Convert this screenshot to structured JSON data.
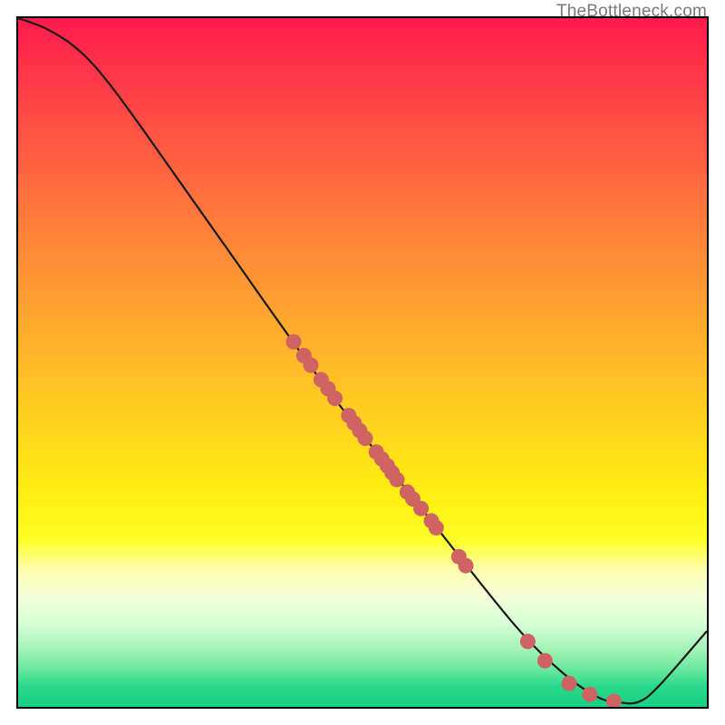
{
  "attribution": "TheBottleneck.com",
  "chart_data": {
    "type": "line",
    "title": "",
    "xlabel": "",
    "ylabel": "",
    "xlim": [
      0,
      100
    ],
    "ylim": [
      0,
      100
    ],
    "curve": [
      {
        "x": 0,
        "y": 100
      },
      {
        "x": 4,
        "y": 98.5
      },
      {
        "x": 8,
        "y": 96
      },
      {
        "x": 12,
        "y": 92
      },
      {
        "x": 18,
        "y": 84
      },
      {
        "x": 30,
        "y": 67
      },
      {
        "x": 45,
        "y": 46
      },
      {
        "x": 60,
        "y": 27
      },
      {
        "x": 72,
        "y": 12
      },
      {
        "x": 79,
        "y": 5
      },
      {
        "x": 84,
        "y": 1.5
      },
      {
        "x": 87,
        "y": 0.7
      },
      {
        "x": 90,
        "y": 0.7
      },
      {
        "x": 93,
        "y": 3
      },
      {
        "x": 100,
        "y": 11
      }
    ],
    "dots": [
      {
        "x": 40,
        "y": 53
      },
      {
        "x": 41.5,
        "y": 51
      },
      {
        "x": 42.5,
        "y": 49.6
      },
      {
        "x": 44,
        "y": 47.5
      },
      {
        "x": 45,
        "y": 46.2
      },
      {
        "x": 46,
        "y": 44.8
      },
      {
        "x": 48,
        "y": 42.3
      },
      {
        "x": 48.8,
        "y": 41.2
      },
      {
        "x": 49.6,
        "y": 40.1
      },
      {
        "x": 50.4,
        "y": 39.0
      },
      {
        "x": 52,
        "y": 37
      },
      {
        "x": 52.8,
        "y": 36
      },
      {
        "x": 53.6,
        "y": 35
      },
      {
        "x": 54.3,
        "y": 34
      },
      {
        "x": 55,
        "y": 33
      },
      {
        "x": 56.5,
        "y": 31.2
      },
      {
        "x": 57.3,
        "y": 30.2
      },
      {
        "x": 58.5,
        "y": 28.8
      },
      {
        "x": 60,
        "y": 27
      },
      {
        "x": 60.7,
        "y": 26
      },
      {
        "x": 64,
        "y": 21.8
      },
      {
        "x": 65,
        "y": 20.5
      },
      {
        "x": 74,
        "y": 9.5
      },
      {
        "x": 76.5,
        "y": 6.7
      },
      {
        "x": 80,
        "y": 3.4
      },
      {
        "x": 83,
        "y": 1.8
      },
      {
        "x": 86.5,
        "y": 0.8
      }
    ],
    "colors": {
      "curve": "#181818",
      "dot_fill": "#cf6262",
      "dot_stroke": "#bb4e4e",
      "gradient_top": "#ff1a4d",
      "gradient_bottom": "#15d084"
    }
  }
}
